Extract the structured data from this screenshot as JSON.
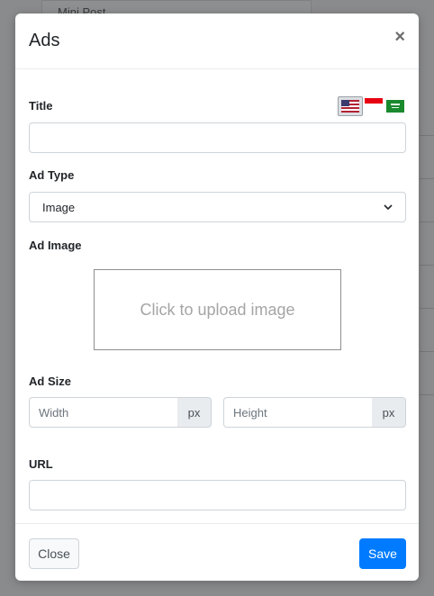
{
  "background": {
    "card_title": "Mini Post"
  },
  "modal": {
    "title": "Ads",
    "close_glyph": "×",
    "fields": {
      "title_label": "Title",
      "ad_type_label": "Ad Type",
      "ad_type_selected": "Image",
      "ad_image_label": "Ad Image",
      "upload_text": "Click to upload image",
      "ad_size_label": "Ad Size",
      "width_placeholder": "Width",
      "height_placeholder": "Height",
      "unit": "px",
      "url_label": "URL"
    },
    "languages": [
      "us-flag-icon",
      "indonesia-flag-icon",
      "saudi-flag-icon"
    ],
    "footer": {
      "close_label": "Close",
      "save_label": "Save"
    }
  },
  "colors": {
    "primary": "#007bff",
    "backdrop": "#7b7c7e"
  }
}
